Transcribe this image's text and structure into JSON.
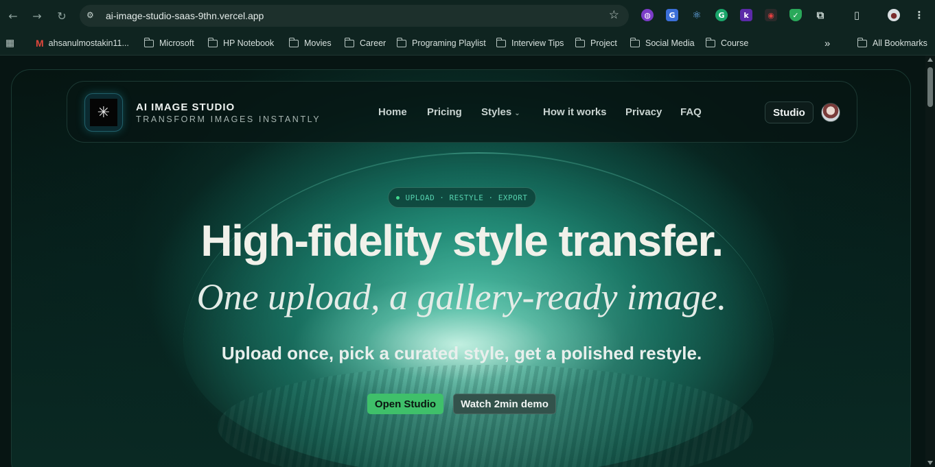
{
  "browser": {
    "url": "ai-image-studio-saas-9thn.vercel.app",
    "bookmarks": [
      {
        "label": "ahsanulmostakin11...",
        "icon": "gmail-icon"
      },
      {
        "label": "Microsoft",
        "icon": "folder-icon"
      },
      {
        "label": "HP Notebook",
        "icon": "folder-icon"
      },
      {
        "label": "Movies",
        "icon": "folder-icon"
      },
      {
        "label": "Career",
        "icon": "folder-icon"
      },
      {
        "label": "Programing Playlist",
        "icon": "folder-icon"
      },
      {
        "label": "Interview Tips",
        "icon": "folder-icon"
      },
      {
        "label": "Project",
        "icon": "folder-icon"
      },
      {
        "label": "Social Media",
        "icon": "folder-icon"
      },
      {
        "label": "Course",
        "icon": "folder-icon"
      }
    ],
    "more_bookmarks": "»",
    "all_bookmarks": "All Bookmarks"
  },
  "site": {
    "brand_title": "AI IMAGE STUDIO",
    "brand_subtitle": "TRANSFORM IMAGES INSTANTLY",
    "nav": {
      "home": "Home",
      "pricing": "Pricing",
      "styles": "Styles",
      "how_it_works": "How it works",
      "privacy": "Privacy",
      "faq": "FAQ"
    },
    "studio_button": "Studio",
    "pill": "UPLOAD · RESTYLE · EXPORT",
    "headline": "High-fidelity style transfer.",
    "subheadline": "One upload, a gallery-ready image.",
    "lead": "Upload once, pick a curated style, get a polished restyle.",
    "cta_primary": "Open Studio",
    "cta_secondary": "Watch 2min demo"
  },
  "colors": {
    "accent_green": "#3fc06a",
    "pill_text": "#56d1ae"
  }
}
